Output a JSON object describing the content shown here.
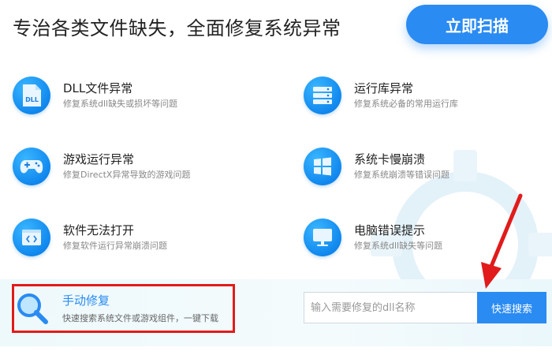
{
  "header": {
    "headline": "专治各类文件缺失，全面修复系统异常",
    "scan_button": "立即扫描"
  },
  "items": [
    {
      "title": "DLL文件异常",
      "desc": "修复系统dll缺失或损坏等问题",
      "icon": "dll-file-icon",
      "icon_text": "DLL"
    },
    {
      "title": "运行库异常",
      "desc": "修复系统必备的常用运行库",
      "icon": "server-stack-icon"
    },
    {
      "title": "游戏运行异常",
      "desc": "修复DirectX异常导致的游戏问题",
      "icon": "gamepad-icon"
    },
    {
      "title": "系统卡慢崩溃",
      "desc": "修复系统崩溃等错误问题",
      "icon": "windows-logo-icon"
    },
    {
      "title": "软件无法打开",
      "desc": "修复软件运行异常崩溃问题",
      "icon": "code-window-icon"
    },
    {
      "title": "电脑错误提示",
      "desc": "修复系统dll缺失等问题",
      "icon": "monitor-icon"
    }
  ],
  "manual": {
    "title": "手动修复",
    "desc": "快速搜索系统文件或游戏组件，一键下载",
    "icon": "magnifier-icon"
  },
  "search": {
    "placeholder": "输入需要修复的dll名称",
    "value": "",
    "button": "快速搜索"
  },
  "colors": {
    "accent": "#2a8bf2",
    "highlight_box": "#e11b1b",
    "arrow": "#e11b1b"
  }
}
